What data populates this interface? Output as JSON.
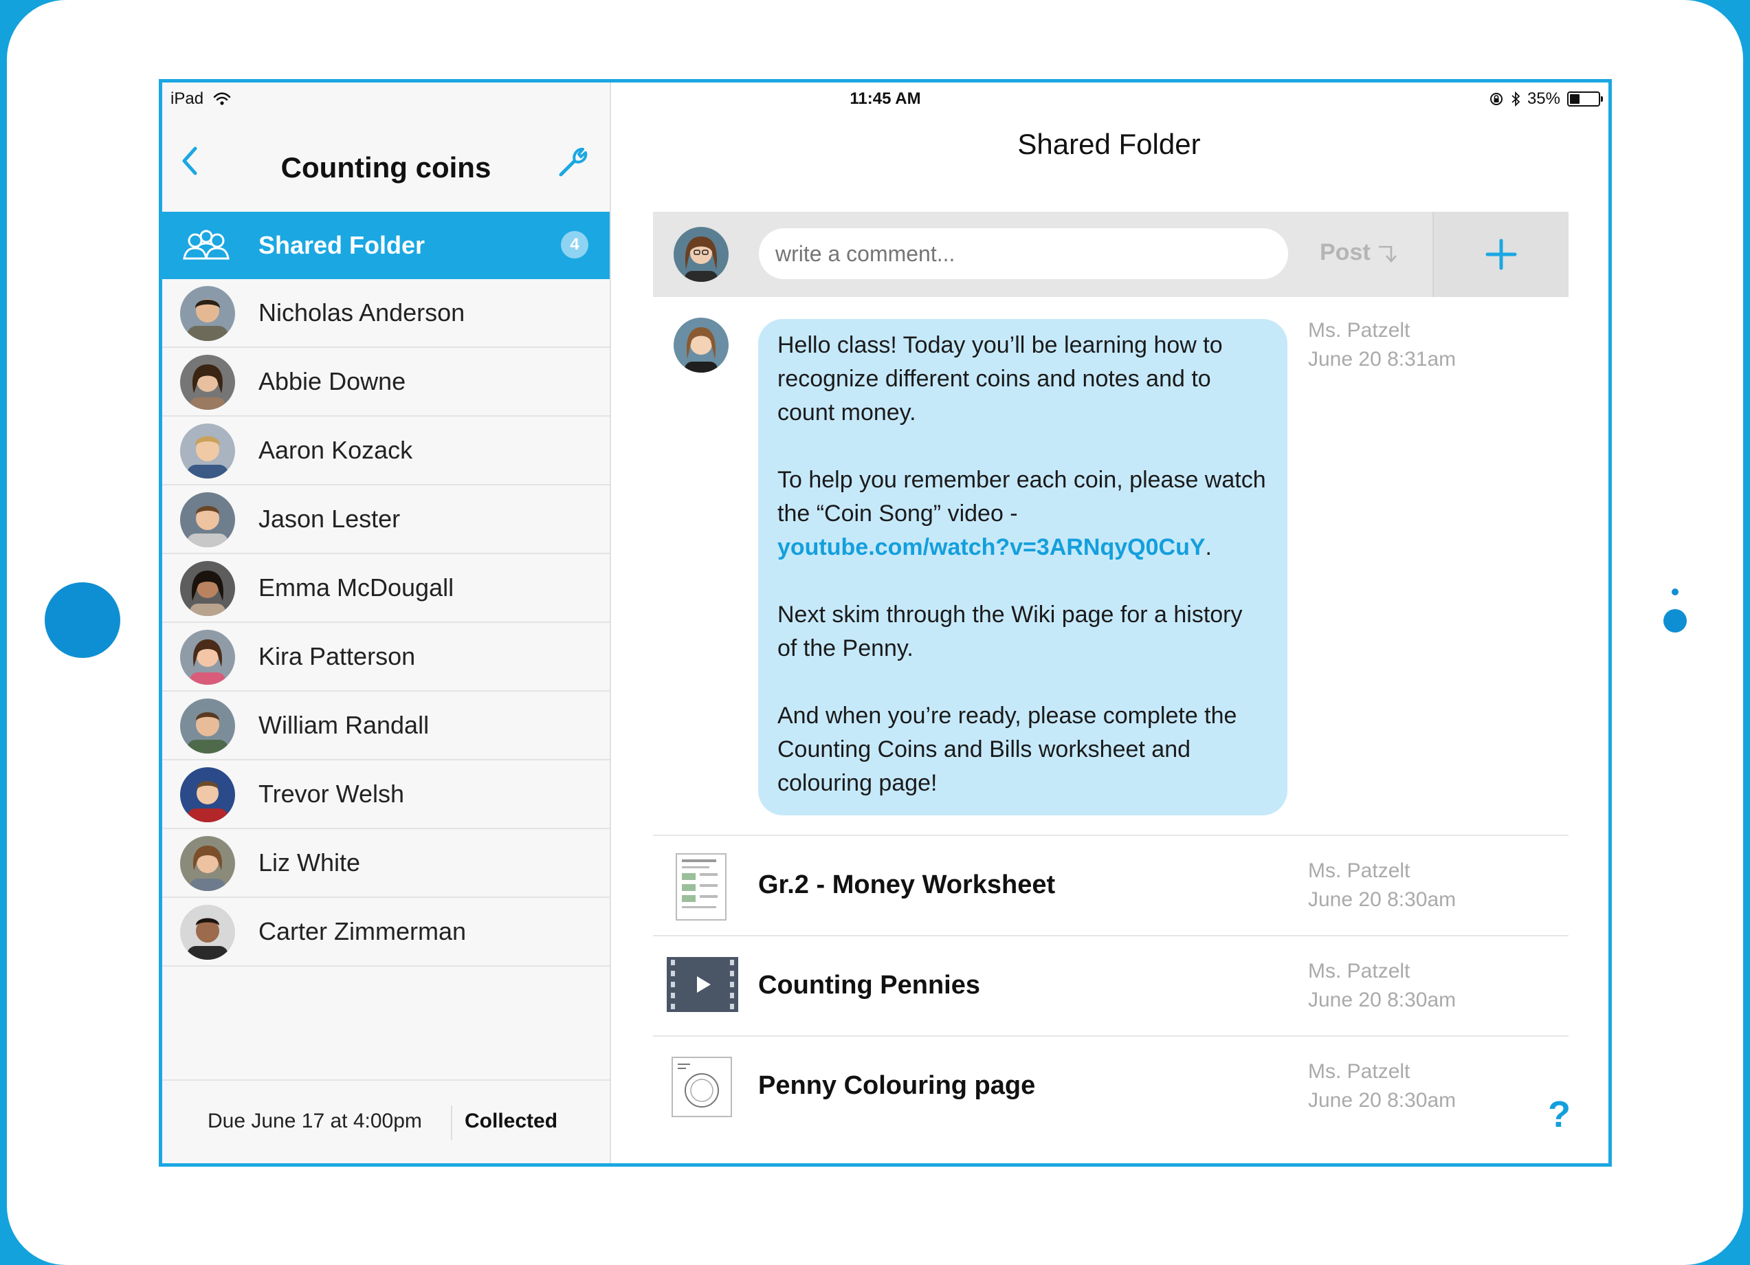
{
  "status_bar": {
    "device": "iPad",
    "time": "11:45 AM",
    "battery": "35%",
    "battery_level": 0.35
  },
  "left_panel": {
    "title": "Counting coins",
    "shared_folder": {
      "label": "Shared Folder",
      "badge": "4"
    },
    "students": [
      "Nicholas Anderson",
      "Abbie Downe",
      "Aaron Kozack",
      "Jason Lester",
      "Emma McDougall",
      "Kira Patterson",
      "William Randall",
      "Trevor Welsh",
      "Liz White",
      "Carter Zimmerman"
    ],
    "footer": {
      "due": "Due June 17 at 4:00pm",
      "status": "Collected"
    }
  },
  "main": {
    "title": "Shared Folder",
    "composer": {
      "placeholder": "write a comment...",
      "post_label": "Post"
    },
    "message": {
      "paragraphs": [
        "Hello class! Today you’ll be learning how to recognize different coins and notes and to count money.",
        "To help you remember each coin, please watch the “Coin Song” video -",
        "Next skim through the Wiki page for a history of the Penny.",
        "And when you’re ready, please complete the Counting Coins and Bills worksheet and colouring page!"
      ],
      "link": "youtube.com/watch?v=3ARNqyQ0CuY",
      "link_suffix": ".",
      "author": "Ms. Patzelt",
      "date": "June 20 8:31am"
    },
    "files": [
      {
        "title": "Gr.2 - Money Worksheet",
        "author": "Ms. Patzelt",
        "date": "June 20 8:30am",
        "icon": "worksheet-thumbnail"
      },
      {
        "title": "Counting Pennies",
        "author": "Ms. Patzelt",
        "date": "June 20 8:30am",
        "icon": "video-icon"
      },
      {
        "title": "Penny Colouring page",
        "author": "Ms. Patzelt",
        "date": "June 20 8:30am",
        "icon": "colouring-page-thumbnail"
      }
    ],
    "help": "?"
  },
  "colors": {
    "accent": "#1ba7e2",
    "bubble": "#c6e9fa",
    "link": "#149fdc",
    "device_frame": "#13a2dc"
  }
}
